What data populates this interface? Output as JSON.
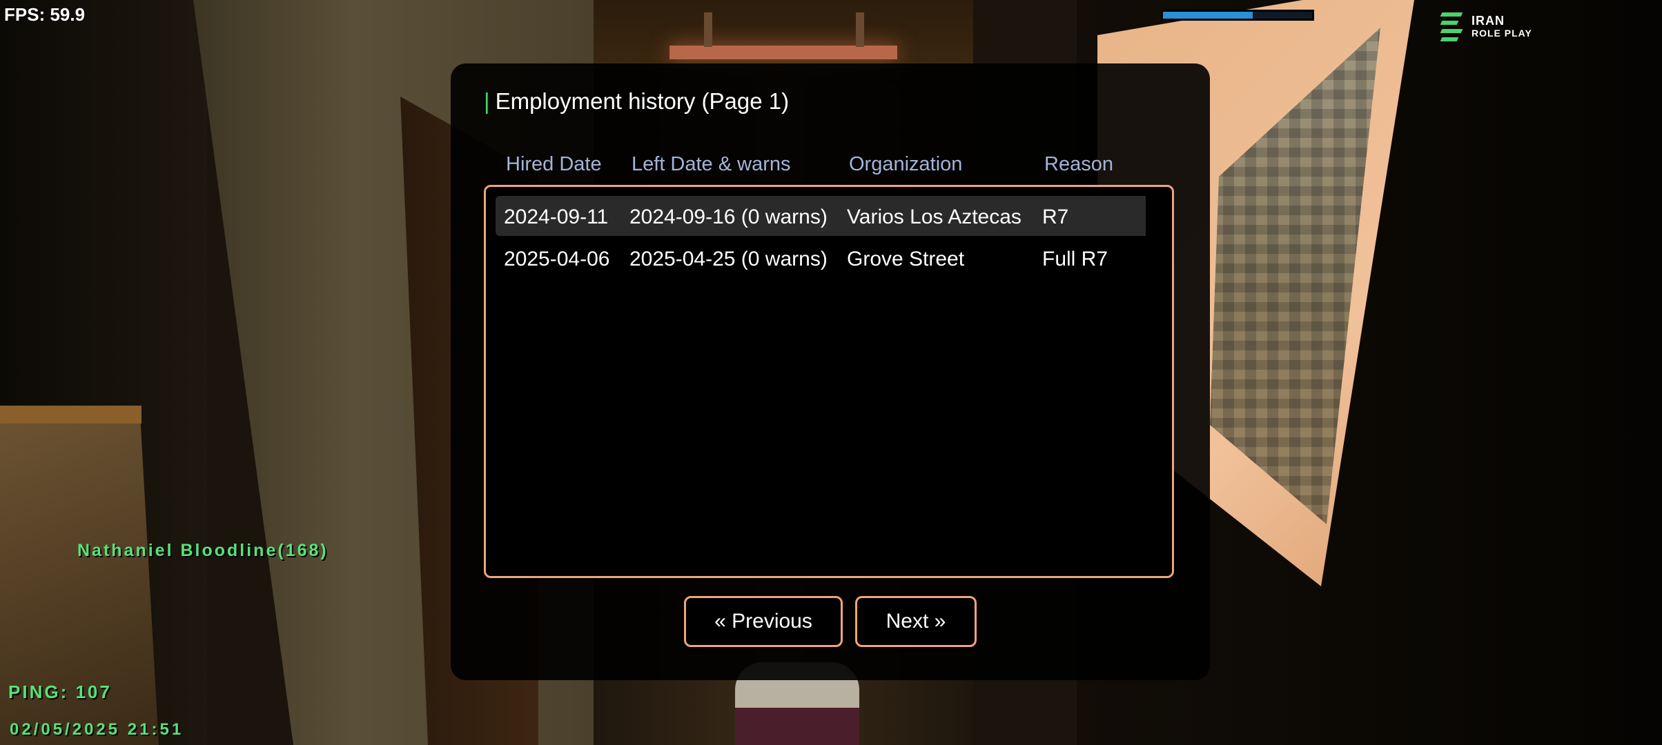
{
  "hud": {
    "fps": "FPS: 59.9",
    "health_fraction": 0.6,
    "health_color": "#2a8fd6",
    "logo_line1": "IRAN",
    "logo_line2": "ROLE PLAY",
    "player_name": "Nathaniel Bloodline(168)",
    "ping": "PING: 107",
    "datetime": "02/05/2025 21:51",
    "text_color": "#56e27a"
  },
  "dialog": {
    "title": "Employment history (Page 1)",
    "accent_color": "#3fd86b",
    "border_color": "#f0a57a",
    "columns": [
      "Hired Date",
      "Left Date & warns",
      "Organization",
      "Reason"
    ],
    "rows": [
      {
        "hired": "2024-09-11",
        "left": "2024-09-16 (0 warns)",
        "organization": "Varios Los Aztecas",
        "reason": "R7",
        "selected": true
      },
      {
        "hired": "2025-04-06",
        "left": "2025-04-25 (0 warns)",
        "organization": "Grove Street",
        "reason": "Full R7",
        "selected": false
      }
    ],
    "prev_label": "« Previous",
    "next_label": "Next »"
  }
}
